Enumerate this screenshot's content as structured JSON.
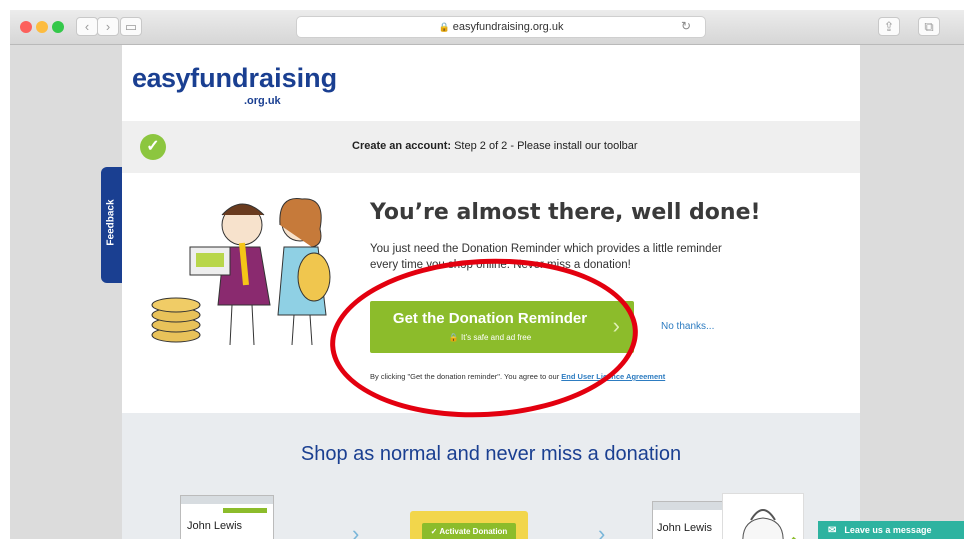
{
  "browser": {
    "url": "easyfundraising.org.uk"
  },
  "logo": {
    "easy": "easy",
    "fundraising": "fundraising",
    "domain": ".org.uk"
  },
  "step": {
    "label": "Create an account:",
    "text": "Step 2 of 2 - Please install our toolbar"
  },
  "feedback_label": "Feedback",
  "hero": {
    "headline": "You’re almost there, well done!",
    "body": "You just need the Donation Reminder which provides a little reminder every time you shop online. Never miss a donation!",
    "cta_main": "Get the Donation Reminder",
    "cta_sub": "It’s safe and ad free",
    "no_thanks": "No thanks...",
    "agree_text": "By clicking \"Get the donation reminder\". You agree to our ",
    "agree_link": "End User Licence Agreement"
  },
  "lower": {
    "title": "Shop as normal and never miss a donation",
    "card1_brand": "John Lewis",
    "activate": "Activate Donation",
    "card3_brand": "John Lewis"
  },
  "chat": {
    "label": "Leave us a message"
  },
  "colors": {
    "brand": "#1a3f91",
    "green": "#8cbc2b",
    "annotation": "#e3000f"
  }
}
